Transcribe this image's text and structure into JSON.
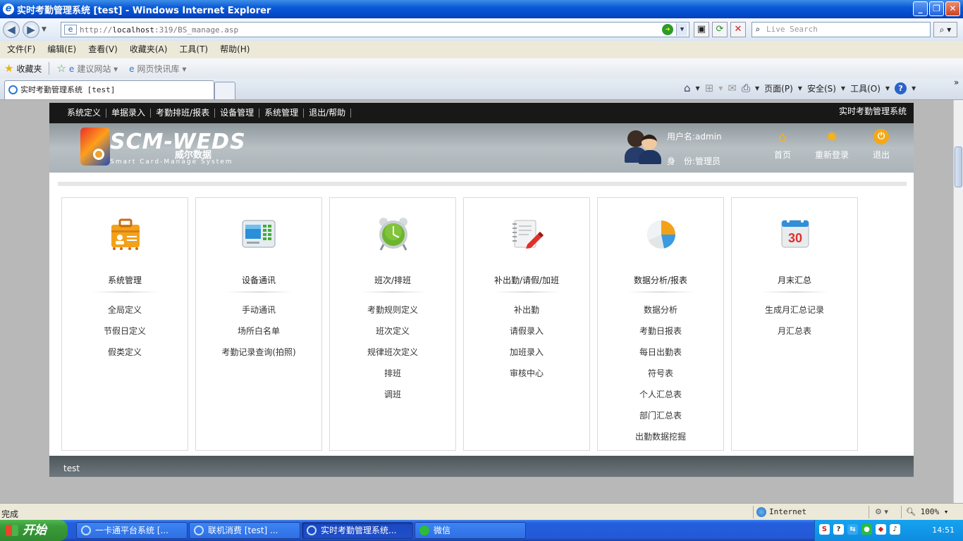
{
  "window": {
    "title": "实时考勤管理系统 [test] - Windows Internet Explorer"
  },
  "address": {
    "url_prefix": "http://",
    "url_host": "localhost",
    "url_rest": ":319/BS_manage.asp",
    "search_placeholder": "Live Search"
  },
  "menu": [
    "文件(F)",
    "编辑(E)",
    "查看(V)",
    "收藏夹(A)",
    "工具(T)",
    "帮助(H)"
  ],
  "favorites": {
    "label": "收藏夹",
    "items": [
      "建议网站 ▾",
      "网页快讯库 ▾"
    ]
  },
  "tab": {
    "title": "实时考勤管理系统 [test]"
  },
  "commands": {
    "page": "页面(P)",
    "safety": "安全(S)",
    "tools": "工具(O)"
  },
  "app": {
    "nav": [
      "系统定义",
      "单据录入",
      "考勤排班/报表",
      "设备管理",
      "系统管理",
      "退出/帮助"
    ],
    "system_name": "实时考勤管理系统",
    "logo": {
      "text": "SCM-WEDS",
      "cn": "威尔数据",
      "en": "Smart Card-Manage System"
    },
    "user": {
      "name": "用户名:admin",
      "role": "身　份:管理员"
    },
    "actions": {
      "home": "首页",
      "relogin": "重新登录",
      "exit": "退出"
    },
    "modules": [
      {
        "title": "系统管理",
        "icon": "briefcase-icon",
        "items": [
          "全局定义",
          "节假日定义",
          "假类定义"
        ]
      },
      {
        "title": "设备通讯",
        "icon": "terminal-device-icon",
        "items": [
          "手动通讯",
          "场所白名单",
          "考勤记录查询(拍照)"
        ]
      },
      {
        "title": "班次/排班",
        "icon": "alarm-clock-icon",
        "items": [
          "考勤规则定义",
          "班次定义",
          "规律班次定义",
          "排班",
          "调班"
        ]
      },
      {
        "title": "补出勤/请假/加班",
        "icon": "notebook-pen-icon",
        "items": [
          "补出勤",
          "请假录入",
          "加班录入",
          "审核中心"
        ]
      },
      {
        "title": "数据分析/报表",
        "icon": "pie-chart-icon",
        "items": [
          "数据分析",
          "考勤日报表",
          "每日出勤表",
          "符号表",
          "个人汇总表",
          "部门汇总表",
          "出勤数据挖掘"
        ]
      },
      {
        "title": "月末汇总",
        "icon": "calendar-icon",
        "items": [
          "生成月汇总记录",
          "月汇总表"
        ]
      }
    ],
    "calendar_day": "30",
    "footer": "test"
  },
  "status": {
    "text": "完成",
    "zone": "Internet",
    "zoom": "100% ▾"
  },
  "taskbar": {
    "start": "开始",
    "tasks": [
      "一卡通平台系统 [...",
      "联机消费 [test] ...",
      "实时考勤管理系统...",
      "微信"
    ],
    "clock": "14:51"
  }
}
